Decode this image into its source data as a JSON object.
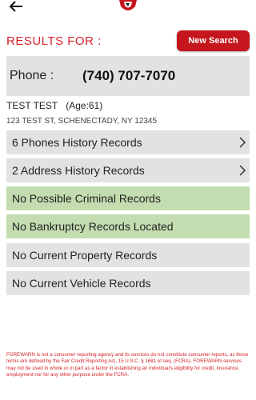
{
  "header": {
    "back_icon": "arrow-left-icon",
    "logo_icon": "shield-logo-icon"
  },
  "results": {
    "label": "RESULTS FOR   :",
    "new_search_label": "New Search"
  },
  "phone": {
    "label": "Phone   :",
    "value": "(740) 707-7070"
  },
  "person": {
    "name": "TEST TEST",
    "age": "(Age:61)",
    "address": "123 TEST ST, SCHENECTADY, NY 12345"
  },
  "records": [
    {
      "label": "6 Phones History Records",
      "status": "gray",
      "chevron": true
    },
    {
      "label": "2 Address History Records",
      "status": "gray",
      "chevron": true
    },
    {
      "label": "No Possible Criminal Records",
      "status": "green",
      "chevron": false
    },
    {
      "label": "No Bankruptcy Records Located",
      "status": "green",
      "chevron": false
    },
    {
      "label": "No Current Property Records",
      "status": "gray",
      "chevron": false
    },
    {
      "label": "No Current Vehicle Records",
      "status": "gray",
      "chevron": false
    }
  ],
  "disclaimer": "FOREWARN is not a consumer reporting agency and its services do not constitute consumer reports, as these terms are defined by the Fair Credit Reporting Act, 15 U.S.C. § 1681 et seq. (FCRA). FOREWARN services may not be used in whole or in part as a factor in establishing an individual's eligibility for credit, insurance, employment nor for any other purpose under the FCRA.",
  "colors": {
    "accent_red": "#c4161c",
    "text_red": "#d6242b",
    "row_gray": "#e2e2e2",
    "row_green": "#c4ddb0"
  }
}
